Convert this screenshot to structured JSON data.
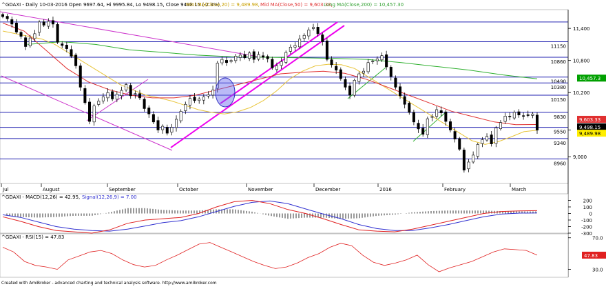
{
  "header": {
    "main": "^GDAXI - Daily 10-03-2016 Open 9697.64, Hi 9995.84, Lo 9498.15, Close 9498.15 (-2.3%)",
    "ma20": "Mini MA(Close,20) = 9,489.98,",
    "ma50": "Mid MA(Close,50) = 9,603.33,",
    "ma200": "Long MA(Close,200) = 10,457.30",
    "macd_name": "^GDAXI - MACD(12,26) = 42.95,",
    "macd_signal": "Signal(12,26,9) = 7.00",
    "rsi_name": "^GDAXI - RSI(15) = 47.83"
  },
  "footer": "Created with AmiBroker - advanced charting and technical analysis software. http://www.amibroker.com",
  "months": [
    "Jul",
    "August",
    "September",
    "October",
    "November",
    "December",
    "2016",
    "February",
    "March"
  ],
  "colors": {
    "ma20": "#e8c438",
    "ma50": "#e03030",
    "ma200": "#30b030",
    "levels": "#2020b0",
    "trend": "#ee00ee",
    "trend2": "#cc33cc",
    "macd": "#e02020",
    "signal": "#3030d0",
    "rsi": "#e02020",
    "price_box": "#000000",
    "ma50_box": "#e03030",
    "ma20_box": "#ffee00",
    "ma200_box": "#00a000"
  },
  "chart_data": [
    {
      "type": "candlestick",
      "name": "^GDAXI",
      "ylim": [
        8500,
        11750
      ],
      "y_ticks": [
        9000,
        9500,
        10200,
        10800,
        11400
      ],
      "y_tick_labels": [
        "9,000",
        "",
        "10,200",
        "10,800",
        "11,400"
      ],
      "levels": [
        11150,
        10860,
        10490,
        10380,
        10150,
        9830,
        9550,
        9340,
        8960,
        11520
      ],
      "level_labels": [
        "11150",
        "10860",
        "10490",
        "10380",
        "10150",
        "9830",
        "9550",
        "9340",
        "8960",
        ""
      ],
      "last_values": {
        "price": "9,498.15",
        "ma50": "9,603.33",
        "ma20": "9,489.98",
        "ma200": "10,457.3"
      },
      "closes": [
        11620,
        11580,
        11480,
        11330,
        11250,
        11060,
        11220,
        11300,
        11520,
        11460,
        11530,
        11480,
        11140,
        11080,
        11020,
        10880,
        10700,
        10300,
        10010,
        9660,
        9950,
        10040,
        10120,
        10200,
        10080,
        10170,
        10240,
        10350,
        10140,
        10180,
        10100,
        9900,
        9800,
        9650,
        9500,
        9570,
        9440,
        9550,
        9700,
        9850,
        9980,
        10090,
        10050,
        10080,
        10120,
        10160,
        10250,
        10750,
        10820,
        10760,
        10800,
        10880,
        10900,
        10850,
        10940,
        10820,
        10910,
        10860,
        10830,
        10660,
        10700,
        10780,
        10950,
        11050,
        11080,
        11200,
        11270,
        11370,
        11420,
        11300,
        11150,
        10820,
        10720,
        10620,
        10460,
        10300,
        10150,
        10430,
        10550,
        10600,
        10760,
        10790,
        10830,
        10890,
        10680,
        10500,
        10300,
        10140,
        9980,
        9830,
        9650,
        9520,
        9420,
        9710,
        9750,
        9880,
        9820,
        9660,
        9500,
        9330,
        9140,
        8750,
        8900,
        9030,
        9230,
        9320,
        9380,
        9240,
        9540,
        9640,
        9760,
        9750,
        9830,
        9780,
        9760,
        9770,
        9800,
        9498
      ],
      "ma20": [
        11350,
        11300,
        11250,
        11200,
        11100,
        10950,
        10800,
        10650,
        10500,
        10350,
        10250,
        10150,
        10100,
        10040,
        9960,
        9880,
        9830,
        9800,
        9840,
        9920,
        10050,
        10230,
        10450,
        10600,
        10700,
        10730,
        10720,
        10650,
        10500,
        10350,
        10200,
        10050,
        9900,
        9750,
        9600,
        9450,
        9300,
        9230,
        9280,
        9370,
        9470,
        9495
      ],
      "ma50": [
        11500,
        11350,
        11000,
        10650,
        10400,
        10250,
        10150,
        10100,
        10100,
        10150,
        10250,
        10350,
        10450,
        10550,
        10580,
        10600,
        10560,
        10450,
        10300,
        10150,
        10000,
        9850,
        9750,
        9650,
        9600,
        9603
      ],
      "ma200": [
        11100,
        11150,
        11100,
        11000,
        10950,
        10900,
        10870,
        10860,
        10850,
        10840,
        10820,
        10760,
        10690,
        10620,
        10530,
        10457
      ]
    },
    {
      "type": "histogram+line",
      "name": "MACD(12,26)",
      "ylim": [
        -300,
        300
      ],
      "y_ticks": [
        200,
        100,
        0,
        -100,
        -200,
        -300
      ],
      "y_tick_labels": [
        "200",
        "100",
        "0",
        "-100",
        "-200",
        "-300"
      ],
      "macd": [
        -50,
        -120,
        -200,
        -260,
        -280,
        -300,
        -250,
        -150,
        -100,
        -80,
        -60,
        0,
        100,
        180,
        200,
        150,
        60,
        0,
        -80,
        -170,
        -250,
        -270,
        -280,
        -240,
        -180,
        -120,
        -60,
        0,
        30,
        40,
        43
      ],
      "signal": [
        -20,
        -60,
        -130,
        -200,
        -240,
        -260,
        -270,
        -240,
        -190,
        -140,
        -110,
        -50,
        30,
        110,
        170,
        190,
        150,
        70,
        -10,
        -80,
        -170,
        -230,
        -260,
        -260,
        -220,
        -170,
        -110,
        -50,
        -10,
        5,
        7
      ]
    },
    {
      "type": "line",
      "name": "RSI(15)",
      "ylim": [
        20,
        75
      ],
      "y_ticks": [
        70,
        30
      ],
      "y_tick_labels": [
        "70.0",
        "30.0"
      ],
      "last_value": "47.83",
      "values": [
        58,
        52,
        40,
        35,
        33,
        30,
        42,
        47,
        52,
        54,
        50,
        42,
        36,
        33,
        35,
        42,
        48,
        55,
        62,
        64,
        58,
        52,
        46,
        40,
        35,
        31,
        33,
        38,
        45,
        50,
        58,
        63,
        60,
        48,
        39,
        35,
        38,
        42,
        48,
        36,
        27,
        32,
        36,
        40,
        46,
        52,
        56,
        55,
        54,
        48
      ]
    }
  ]
}
